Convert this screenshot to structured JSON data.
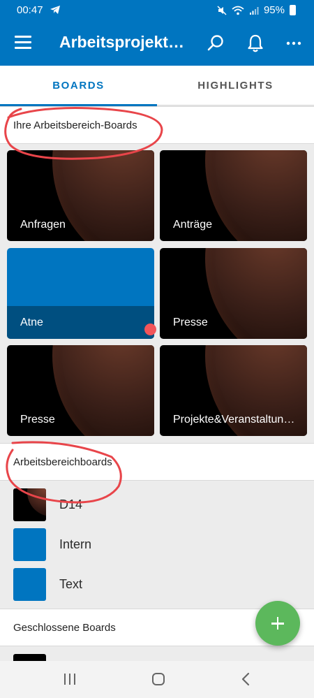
{
  "status_bar": {
    "time": "00:47",
    "battery": "95%"
  },
  "app_bar": {
    "title": "Arbeitsprojekte…",
    "menu_icon": "menu-icon",
    "search_icon": "search-icon",
    "bell_icon": "bell-icon",
    "more_icon": "more-icon"
  },
  "tabs": [
    {
      "label": "BOARDS",
      "active": true
    },
    {
      "label": "HIGHLIGHTS",
      "active": false
    }
  ],
  "sections": {
    "workspace_boards_header": "Ihre Arbeitsbereich-Boards",
    "workspace_list_header": "Arbeitsbereichboards",
    "closed_boards_header": "Geschlossene Boards"
  },
  "boards": [
    {
      "label": "Anfragen"
    },
    {
      "label": "Anträge"
    },
    {
      "label": "Atne"
    },
    {
      "label": "Presse"
    },
    {
      "label": "Presse"
    },
    {
      "label": "Projekte&Veranstaltungen"
    }
  ],
  "list_boards": [
    {
      "label": "D14"
    },
    {
      "label": "Intern"
    },
    {
      "label": "Text"
    }
  ],
  "colors": {
    "primary": "#0075c0",
    "fab": "#5cb85c",
    "notification_dot": "#f2555a",
    "annotation": "#e8454a"
  }
}
